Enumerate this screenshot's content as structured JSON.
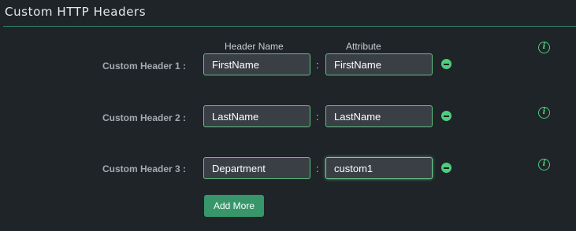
{
  "section": {
    "title": "Custom HTTP Headers"
  },
  "columns": {
    "header_name": "Header Name",
    "attribute": "Attribute"
  },
  "rows": [
    {
      "label": "Custom Header 1 :",
      "header_name": "FirstName",
      "separator": ":",
      "attribute": "FirstName",
      "info": "i"
    },
    {
      "label": "Custom Header 2 :",
      "header_name": "LastName",
      "separator": ":",
      "attribute": "LastName",
      "info": "i"
    },
    {
      "label": "Custom Header 3 :",
      "header_name": "Department",
      "separator": ":",
      "attribute": "custom1",
      "info": "i"
    }
  ],
  "actions": {
    "add_more_label": "Add More"
  },
  "icons": {
    "remove": "minus-circle-icon",
    "info": "info-icon"
  },
  "colors": {
    "background": "#1f2429",
    "accent_green": "#4ccf7c",
    "field_border": "#5fc27f",
    "field_background": "#3a3f46",
    "button_green": "#37966a"
  }
}
